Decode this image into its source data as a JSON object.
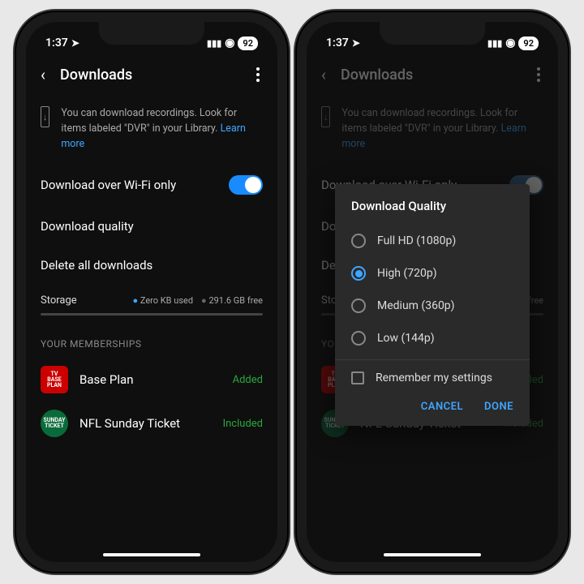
{
  "status": {
    "time": "1:37",
    "battery": "92"
  },
  "header": {
    "title": "Downloads"
  },
  "banner": {
    "text_a": "You can download recordings. Look for items labeled \"DVR\" in your Library. ",
    "learn": "Learn more"
  },
  "settings": {
    "wifi_only": "Download over Wi-Fi only",
    "quality": "Download quality",
    "delete_all": "Delete all downloads"
  },
  "storage": {
    "label": "Storage",
    "used": "Zero KB used",
    "free": "291.6 GB free"
  },
  "memberships": {
    "section": "YOUR MEMBERSHIPS",
    "items": [
      {
        "icon": "TV\nBASE\nPLAN",
        "label": "Base Plan",
        "status": "Added"
      },
      {
        "icon": "SUNDAY\nTICKET",
        "label": "NFL Sunday Ticket",
        "status": "Included"
      }
    ]
  },
  "modal": {
    "title": "Download Quality",
    "options": [
      {
        "label": "Full HD (1080p)",
        "selected": false
      },
      {
        "label": "High (720p)",
        "selected": true
      },
      {
        "label": "Medium (360p)",
        "selected": false
      },
      {
        "label": "Low (144p)",
        "selected": false
      }
    ],
    "remember": "Remember my settings",
    "cancel": "CANCEL",
    "done": "DONE"
  }
}
